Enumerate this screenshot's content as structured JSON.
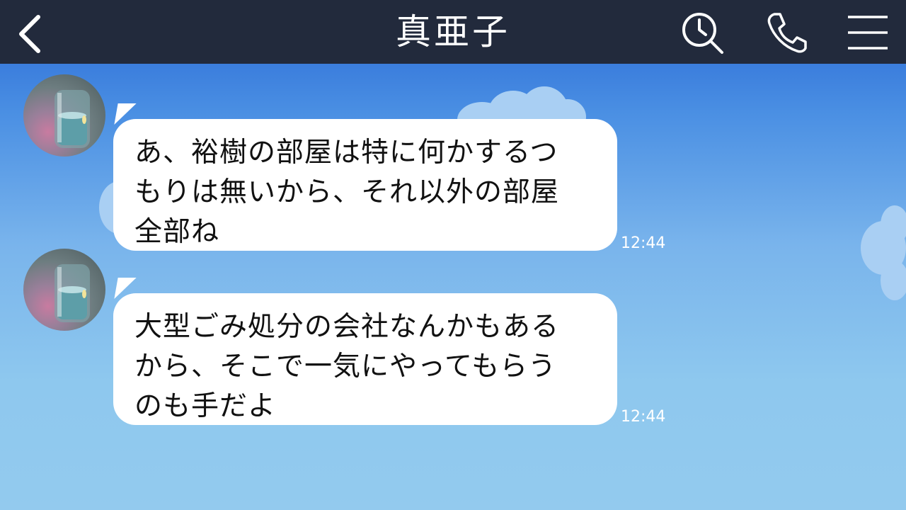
{
  "header": {
    "title": "真亜子",
    "back_icon": "chevron-left-icon",
    "search_icon": "search-icon",
    "call_icon": "phone-icon",
    "menu_icon": "hamburger-menu-icon",
    "background": "#222a3c"
  },
  "messages": [
    {
      "lines": [
        "あ、裕樹の部屋は特に何かするつ",
        "もりは無いから、それ以外の部屋",
        "全部ね"
      ],
      "time": "12:44"
    },
    {
      "lines": [
        "大型ごみ処分の会社なんかもある",
        "から、そこで一気にやってもらう",
        "のも手だよ"
      ],
      "time": "12:44"
    }
  ],
  "colors": {
    "bubble": "#ffffff",
    "background_top": "#2766d4",
    "background_bottom": "#93caee"
  }
}
